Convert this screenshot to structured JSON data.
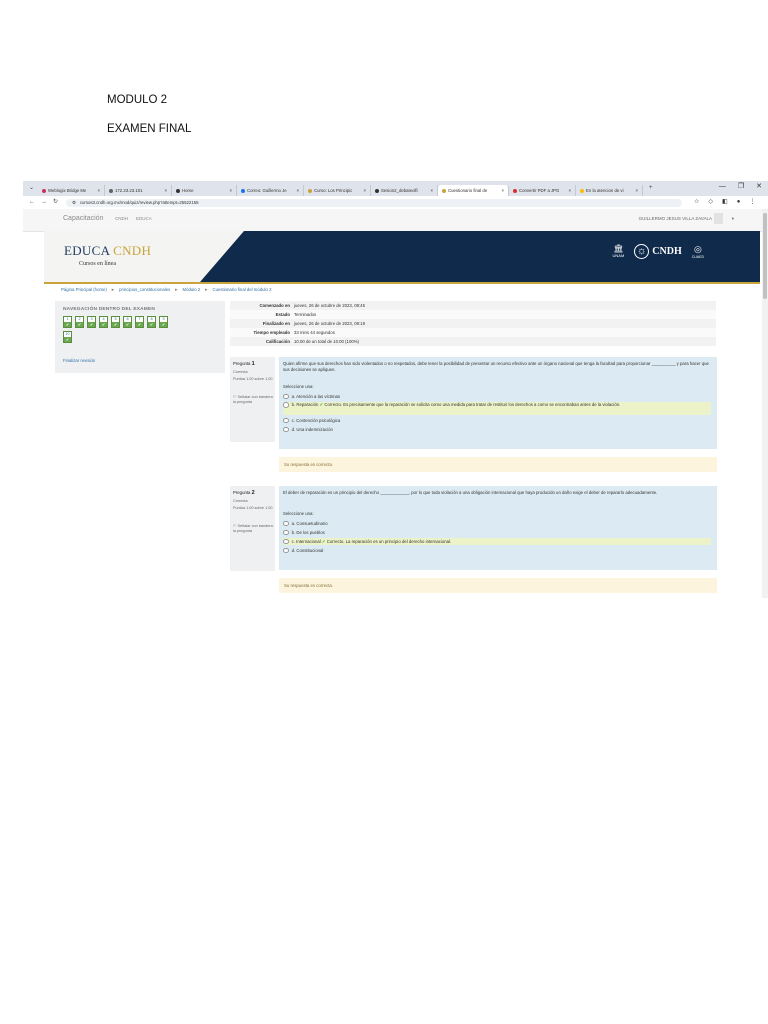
{
  "document": {
    "heading1": "MODULO 2",
    "heading2": "EXAMEN FINAL"
  },
  "browser": {
    "tabs": [
      {
        "label": "Weblogix Bridge Me",
        "color": "#c8325a"
      },
      {
        "label": "172.23.23.101",
        "color": "#5f6368"
      },
      {
        "label": "Home",
        "color": "#333333"
      },
      {
        "label": "Correo: Guillermo Je",
        "color": "#1a73e8"
      },
      {
        "label": "Curso: Los Principio",
        "color": "#c9a43a"
      },
      {
        "label": "Sesion2_debateolfi",
        "color": "#333333"
      },
      {
        "label": "Cuestionario final de",
        "color": "#c9a43a"
      },
      {
        "label": "Convertir PDF a JPG",
        "color": "#d93025"
      },
      {
        "label": "En la atencion de vi",
        "color": "#fbbc04"
      }
    ],
    "active_tab_index": 6,
    "url": "cursos3.cndh.org.mx/mod/quiz/review.php?attempt=25522155",
    "window_controls": [
      "—",
      "❐",
      "✕"
    ]
  },
  "site": {
    "brand": "Capacitación",
    "nav": [
      "CNDH",
      "EDUCA"
    ],
    "user": "GUILLERMO JESUS VILLA ZAVALA",
    "logo_main": "EDUCA ",
    "logo_accent": "CNDH",
    "logo_sub": "Cursos en línea",
    "logo_unam": "UNAM",
    "logo_cndh": "CNDH",
    "logo_cuaed": "CUAED"
  },
  "breadcrumb": [
    "Página Principal (home)",
    "principios_constitucionales",
    "Módulo 2",
    "Cuestionario final del módulo 2"
  ],
  "exam_nav": {
    "title": "NAVEGACIÓN DENTRO DEL EXAMEN",
    "questions": [
      "1",
      "2",
      "3",
      "4",
      "5",
      "6",
      "7",
      "8",
      "9",
      "10"
    ],
    "check": "✔",
    "finish_review": "Finalizar revisión"
  },
  "summary": [
    {
      "key": "Comenzado en",
      "value": "jueves, 26 de octubre de 2023, 08:45"
    },
    {
      "key": "Estado",
      "value": "Terminados"
    },
    {
      "key": "Finalizado en",
      "value": "jueves, 26 de octubre de 2023, 09:19"
    },
    {
      "key": "Tiempo empleado",
      "value": "33 mins 44 segundos"
    },
    {
      "key": "Calificación",
      "value": "10.00 de un total de 10.00 (100%)"
    }
  ],
  "questions": [
    {
      "label": "Pregunta",
      "number": "1",
      "status": "Correcta",
      "points": "Puntúa 1.00 sobre 1.00",
      "flag": "Señalar con bandera la pregunta",
      "text": "Quien afirme que sus derechos han sido violentados o no respetados, debe tener la posibilidad de presentar un recurso efectivo ante un órgano nacional que tenga la facultad para proporcionar __________ y para hacer que sus decisiones se apliquen.",
      "prompt": "Seleccione una:",
      "options": [
        {
          "text": "a. Atención a las víctimas",
          "correct": false,
          "feedback": ""
        },
        {
          "text": "b. Reparación",
          "correct": true,
          "feedback": "Correcto. Es precisamente que la reparación se solicita como una medida para tratar de restituir los derechos a como se encontraban antes de la violación."
        },
        {
          "text": "c. Contención psicológica",
          "correct": false,
          "feedback": ""
        },
        {
          "text": "d. Una indemnización",
          "correct": false,
          "feedback": ""
        }
      ],
      "result": "Su respuesta es correcta."
    },
    {
      "label": "Pregunta",
      "number": "2",
      "status": "Correcta",
      "points": "Puntúa 1.00 sobre 1.00",
      "flag": "Señalar con bandera la pregunta",
      "text": "El deber de reparación es un principio del derecho ____________, por lo que toda violación a una obligación internacional que haya producido un daño exige el deber de repararlo adecuadamente.",
      "prompt": "Seleccione una:",
      "options": [
        {
          "text": "a. Consuetudinario",
          "correct": false,
          "feedback": ""
        },
        {
          "text": "b. De los pueblos",
          "correct": false,
          "feedback": ""
        },
        {
          "text": "c. Internacional",
          "correct": true,
          "feedback": "Correcto. La reparación es un principio del derecho internacional."
        },
        {
          "text": "d. Constitucional",
          "correct": false,
          "feedback": ""
        }
      ],
      "result": "Su respuesta es correcta."
    }
  ],
  "colors": {
    "banner_dark": "#0f2a4a",
    "gold": "#c9a43a",
    "question_bg": "#dcebf3",
    "correct_bg": "#ecf3c8",
    "feedback_bg": "#fcf4dc",
    "check_green": "#6aa84f"
  }
}
